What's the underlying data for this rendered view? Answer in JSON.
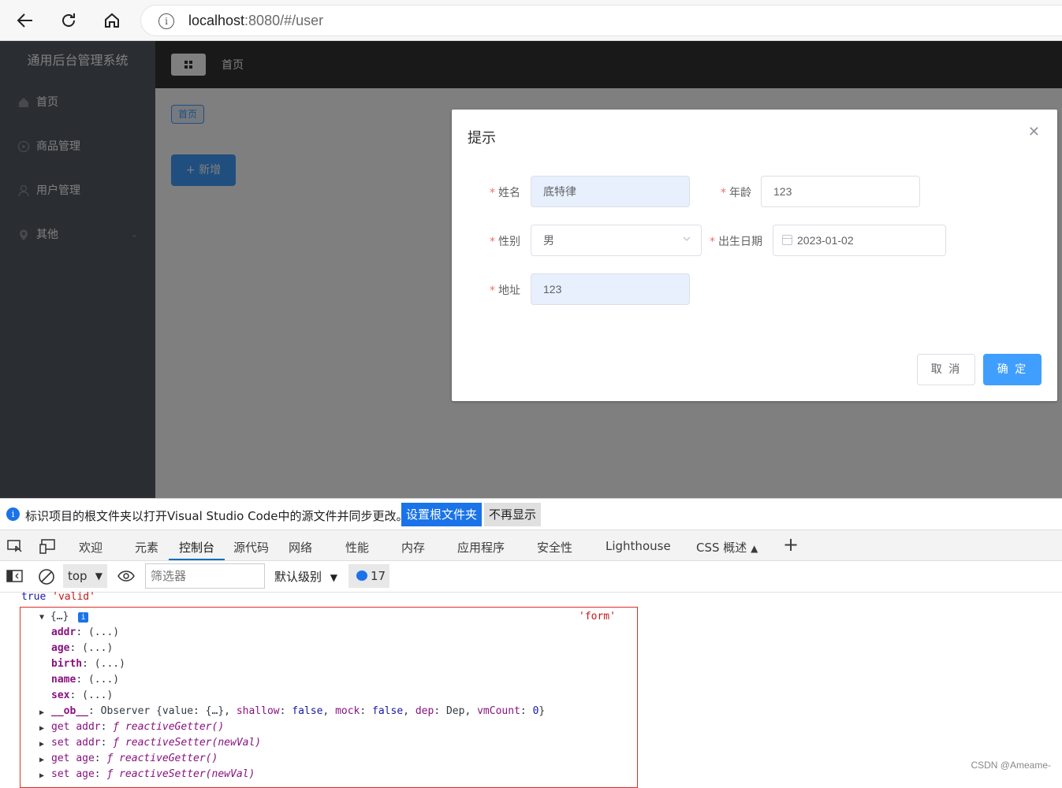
{
  "browser": {
    "url_host": "localhost",
    "url_rest": ":8080/#/user"
  },
  "sidebar": {
    "brand": "通用后台管理系统",
    "items": [
      {
        "label": "首页",
        "icon": "home-icon"
      },
      {
        "label": "商品管理",
        "icon": "video-play-icon"
      },
      {
        "label": "用户管理",
        "icon": "user-icon"
      },
      {
        "label": "其他",
        "icon": "location-icon"
      }
    ]
  },
  "header": {
    "breadcrumb": "首页"
  },
  "main": {
    "tag": "首页",
    "add_button": "+ 新增"
  },
  "dialog": {
    "title": "提示",
    "fields": {
      "name_label": "姓名",
      "name_value": "底特律",
      "age_label": "年龄",
      "age_value": "123",
      "sex_label": "性别",
      "sex_value": "男",
      "birth_label": "出生日期",
      "birth_value": "2023-01-02",
      "addr_label": "地址",
      "addr_value": "123"
    },
    "cancel": "取 消",
    "confirm": "确 定"
  },
  "devtools": {
    "notice_text": "标识项目的根文件夹以打开Visual Studio Code中的源文件并同步更改。",
    "notice_btn_set": "设置根文件夹",
    "notice_btn_hide": "不再显示",
    "tabs": [
      "欢迎",
      "元素",
      "控制台",
      "源代码",
      "网络",
      "性能",
      "内存",
      "应用程序",
      "安全性",
      "Lighthouse",
      "CSS 概述"
    ],
    "active_tab": "控制台",
    "context": "top",
    "filter_placeholder": "筛选器",
    "level": "默认级别",
    "message_count": "17",
    "console": {
      "line1_bool": "true",
      "line1_str": "'valid'",
      "obj_label": "{…}",
      "obj_tag": "'form'",
      "props": [
        "addr",
        "age",
        "birth",
        "name",
        "sex"
      ],
      "prop_value": "(...)",
      "ob_line": {
        "key": "__ob__",
        "text1": ": Observer {value: {…}, ",
        "k_shallow": "shallow",
        "k_mock": "mock",
        "k_dep": "dep",
        "k_vm": "vmCount",
        "v_false": "false",
        "v_dep": "Dep",
        "v_zero": "0"
      },
      "accessors": [
        {
          "kind": "get",
          "name": "addr",
          "fn": "reactiveGetter()"
        },
        {
          "kind": "set",
          "name": "addr",
          "fn": "reactiveSetter(newVal)"
        },
        {
          "kind": "get",
          "name": "age",
          "fn": "reactiveGetter()"
        },
        {
          "kind": "set",
          "name": "age",
          "fn": "reactiveSetter(newVal)"
        }
      ]
    }
  },
  "watermark": "CSDN @Ameame-"
}
